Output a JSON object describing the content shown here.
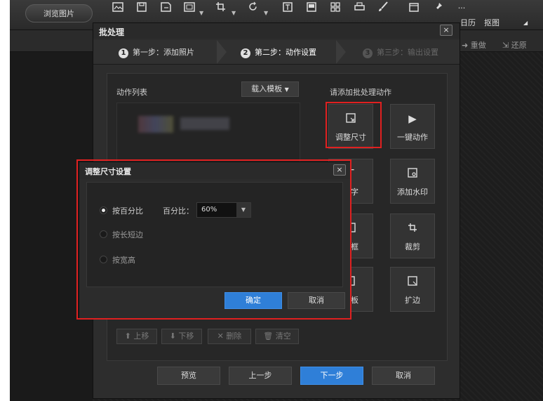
{
  "toolbar": {
    "browse_label": "浏览图片",
    "icons": [
      "image-edit-icon",
      "save-icon",
      "save-as-icon",
      "frame-icon",
      "crop-icon",
      "rotate-icon",
      "text-icon",
      "layers-icon",
      "collage-icon",
      "print-icon",
      "brush-icon",
      "calendar-icon",
      "pin-icon",
      "more-icon"
    ],
    "calendar_label": "日历",
    "matting_label": "抠图",
    "more_label": "···"
  },
  "subbar": {
    "redo_label": "重做",
    "restore_label": "还原"
  },
  "batch_dialog": {
    "title": "批处理",
    "close_label": "×",
    "steps": [
      {
        "num": "1",
        "label": "第一步：添加照片"
      },
      {
        "num": "2",
        "label": "第二步：动作设置"
      },
      {
        "num": "3",
        "label": "第三步：输出设置"
      }
    ],
    "action_list_label": "动作列表",
    "load_template_label": "载入模板",
    "add_actions_label": "请添加批处理动作",
    "actions": [
      {
        "label": "调整尺寸",
        "icon": "resize-icon"
      },
      {
        "label": "一键动作",
        "icon": "play-icon"
      },
      {
        "label": "文字",
        "icon": "text-icon"
      },
      {
        "label": "添加水印",
        "icon": "watermark-icon"
      },
      {
        "label": "边框",
        "icon": "border-icon"
      },
      {
        "label": "裁剪",
        "icon": "crop-icon"
      },
      {
        "label": "模板",
        "icon": "template-icon"
      },
      {
        "label": "扩边",
        "icon": "expand-icon"
      }
    ],
    "list_tools": [
      "上移",
      "下移",
      "删除",
      "清空"
    ],
    "footer": {
      "preview": "预览",
      "prev": "上一步",
      "next": "下一步",
      "cancel": "取消"
    }
  },
  "resize_dialog": {
    "title": "调整尺寸设置",
    "close_label": "×",
    "options": [
      {
        "label": "按百分比",
        "selected": true
      },
      {
        "label": "按长短边",
        "selected": false
      },
      {
        "label": "按宽高",
        "selected": false
      }
    ],
    "percent_label": "百分比：",
    "percent_value": "60%",
    "ok_label": "确定",
    "cancel_label": "取消"
  },
  "colors": {
    "accent": "#2f7fd8",
    "highlight_border": "#e02020"
  }
}
